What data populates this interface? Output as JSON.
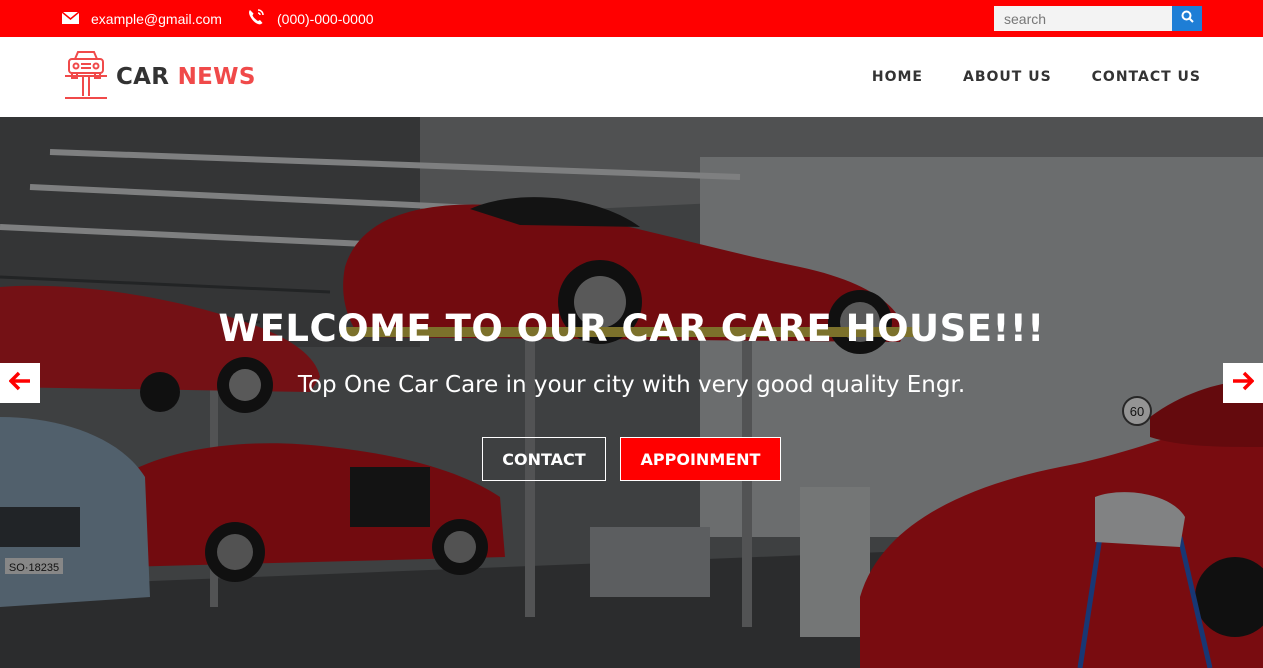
{
  "topbar": {
    "email": "example@gmail.com",
    "phone": "(000)-000-0000",
    "search_placeholder": "search",
    "email_icon": "envelope-icon",
    "phone_icon": "phone-icon",
    "search_icon": "search-icon",
    "background_color": "#ff0000",
    "search_button_color": "#1e7ed6"
  },
  "logo": {
    "text_primary": "CAR",
    "text_accent": "NEWS",
    "icon": "car-lift-icon",
    "accent_color": "#f04a4a"
  },
  "nav": {
    "items": [
      {
        "label": "HOME"
      },
      {
        "label": "ABOUT US"
      },
      {
        "label": "CONTACT US"
      }
    ]
  },
  "hero": {
    "title": "WELCOME TO OUR CAR CARE HOUSE!!!",
    "subtitle": "Top One Car Care in your city with very good quality Engr.",
    "contact_button": "CONTACT",
    "appointment_button": "APPOINMENT",
    "prev_icon": "arrow-left-icon",
    "next_icon": "arrow-right-icon",
    "accent_color": "#ff0000",
    "background_image": "car garage with red sports cars on lifts",
    "sign_speed": "60",
    "plate_text": "SO·18235"
  }
}
